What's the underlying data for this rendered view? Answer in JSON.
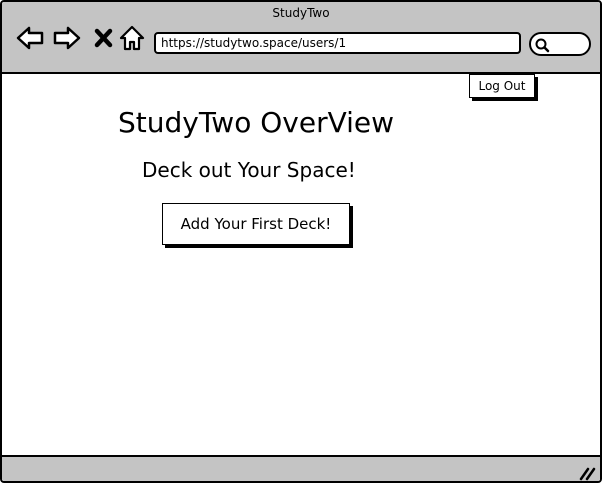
{
  "window": {
    "title": "StudyTwo"
  },
  "nav": {
    "back_icon": "back-arrow-icon",
    "forward_icon": "forward-arrow-icon",
    "stop_icon": "close-icon",
    "home_icon": "home-icon"
  },
  "address_bar": {
    "url": "https://studytwo.space/users/1"
  },
  "search": {
    "icon": "search-icon"
  },
  "header": {
    "logout_label": "Log Out"
  },
  "main": {
    "title": "StudyTwo OverView",
    "subtitle": "Deck out Your Space!",
    "add_deck_label": "Add Your First Deck!"
  },
  "colors": {
    "chrome": "#c4c4c4",
    "border": "#000000",
    "background": "#ffffff"
  }
}
